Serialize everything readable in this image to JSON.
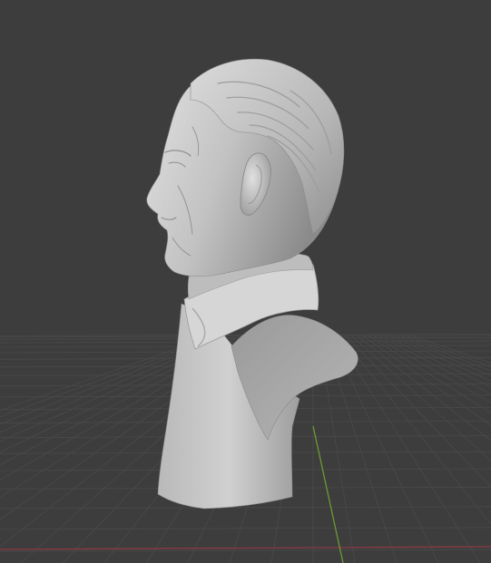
{
  "viewport": {
    "mode": "3d-viewport",
    "colors": {
      "background": "#3d3d3d",
      "grid": "#4a4a4a",
      "x_axis": "#8b3a44",
      "y_axis": "#6c9a33",
      "model": "#c4c4c4"
    }
  },
  "scene": {
    "object": "sculpted-bust",
    "material": "matcap-clay"
  }
}
